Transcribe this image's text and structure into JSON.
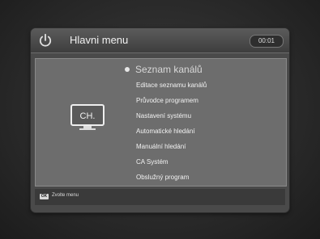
{
  "header": {
    "title": "Hlavni menu",
    "clock": "00:01",
    "icon": "power-icon"
  },
  "main": {
    "icon_label": "CH.",
    "menu_items": [
      "Seznam kanálů",
      "Editace seznamu kanálů",
      "Průvodce programem",
      "Nastavení systému",
      "Automatické hledání",
      "Manuální hledání",
      "CA Systém",
      "Obslužný program"
    ],
    "selected_index": 0
  },
  "footer": {
    "ok_key": "OK",
    "hint": "Zvolte menu"
  }
}
